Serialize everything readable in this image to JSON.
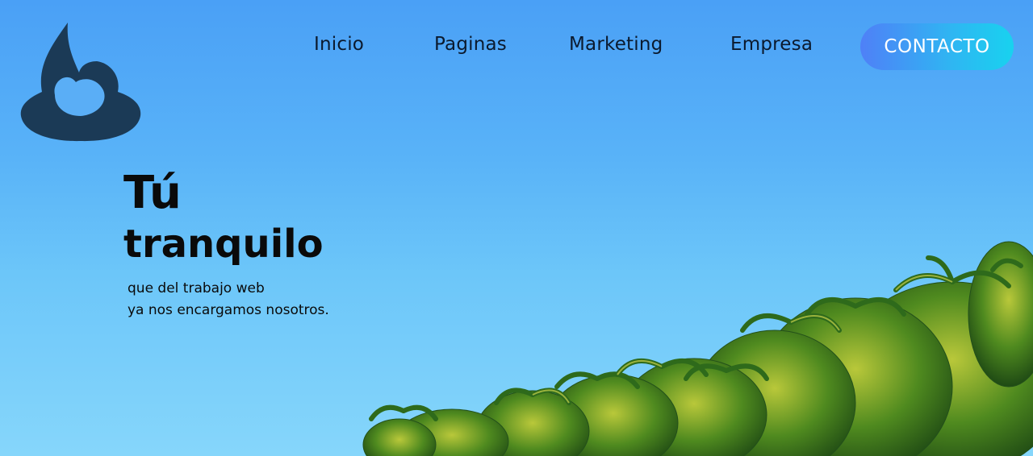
{
  "brand": {
    "logo_icon": "feedburner-flame-icon",
    "logo_color": "#1b3a56"
  },
  "nav": {
    "items": [
      {
        "label": "Inicio"
      },
      {
        "label": "Paginas"
      },
      {
        "label": "Marketing"
      },
      {
        "label": "Empresa"
      }
    ],
    "cta_label": "CONTACTO"
  },
  "hero": {
    "title_line1": "Tú",
    "title_line2": "tranquilo",
    "subtitle_line1": "que del trabajo web",
    "subtitle_line2": "ya nos encargamos nosotros.",
    "background": "palm-trees-sky-image"
  },
  "colors": {
    "sky_top": "#4aa0f6",
    "sky_bottom": "#86d6fb",
    "cta_start": "#4f80f7",
    "cta_end": "#18d2ef",
    "text": "#0a0a0a"
  }
}
